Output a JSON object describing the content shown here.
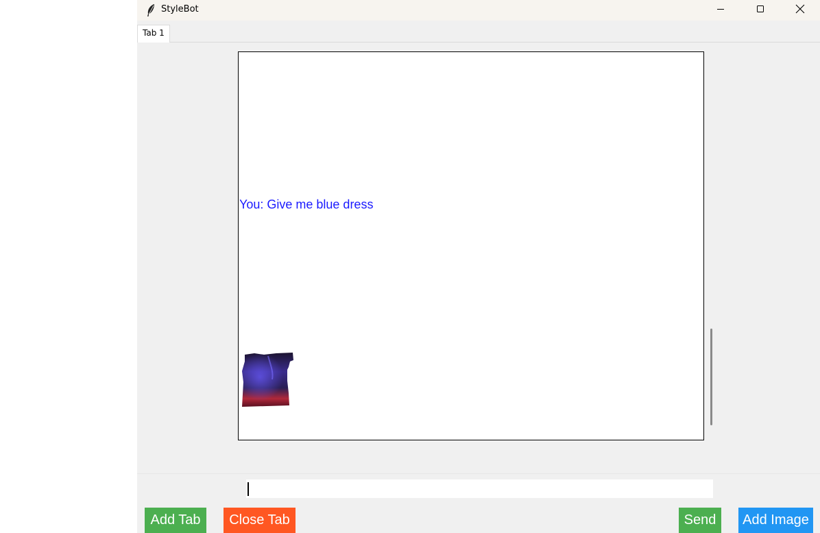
{
  "window": {
    "title": "StyleBot",
    "app_icon": "feather-icon",
    "controls": [
      "minimize-icon",
      "maximize-icon",
      "close-icon"
    ]
  },
  "tabs": [
    {
      "label": "Tab 1",
      "active": true
    }
  ],
  "chat": {
    "messages": [
      {
        "type": "text",
        "text": "You: Give me blue dress",
        "color": "#1a1aff"
      },
      {
        "type": "image",
        "icon": "dress-image"
      }
    ]
  },
  "input": {
    "value": "",
    "placeholder": ""
  },
  "buttons": {
    "add_tab": {
      "label": "Add Tab",
      "color": "#4caf50"
    },
    "close_tab": {
      "label": "Close Tab",
      "color": "#ff5722"
    },
    "send": {
      "label": "Send",
      "color": "#4caf50"
    },
    "add_image": {
      "label": "Add Image",
      "color": "#2196f3"
    }
  }
}
